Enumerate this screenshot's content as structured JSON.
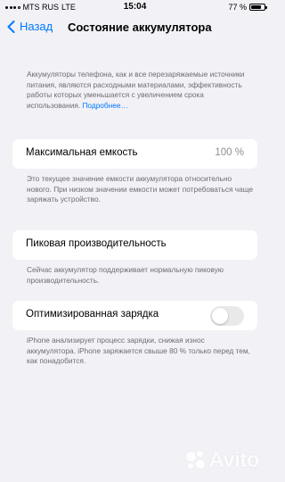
{
  "status_bar": {
    "carrier": "MTS RUS",
    "network": "LTE",
    "time": "15:04",
    "battery_percent_label": "77 %",
    "battery_level": 0.77
  },
  "nav": {
    "back_label": "Назад",
    "title": "Состояние аккумулятора"
  },
  "intro": {
    "text": "Аккумуляторы телефона, как и все перезаряжаемые источники питания, являются расходными материалами, эффективность работы которых уменьшается с увеличением срока использования.",
    "link": "Подробнее…"
  },
  "max_capacity": {
    "label": "Максимальная емкость",
    "value": "100 %",
    "description": "Это текущее значение емкости аккумулятора относительно нового. При низком значении емкости может потребоваться чаще заряжать устройство."
  },
  "peak_performance": {
    "label": "Пиковая производительность",
    "description": "Сейчас аккумулятор поддерживает нормальную пиковую производительность."
  },
  "optimized_charging": {
    "label": "Оптимизированная зарядка",
    "enabled": false,
    "description": "iPhone анализирует процесс зарядки, снижая износ аккумулятора. iPhone заряжается свыше 80 % только перед тем, как понадобится."
  },
  "watermark": {
    "text": "Avito"
  },
  "colors": {
    "background": "#f2f1f6",
    "accent": "#007aff",
    "secondary_text": "#6d6d72",
    "toggle_off": "#e9e9ea"
  }
}
